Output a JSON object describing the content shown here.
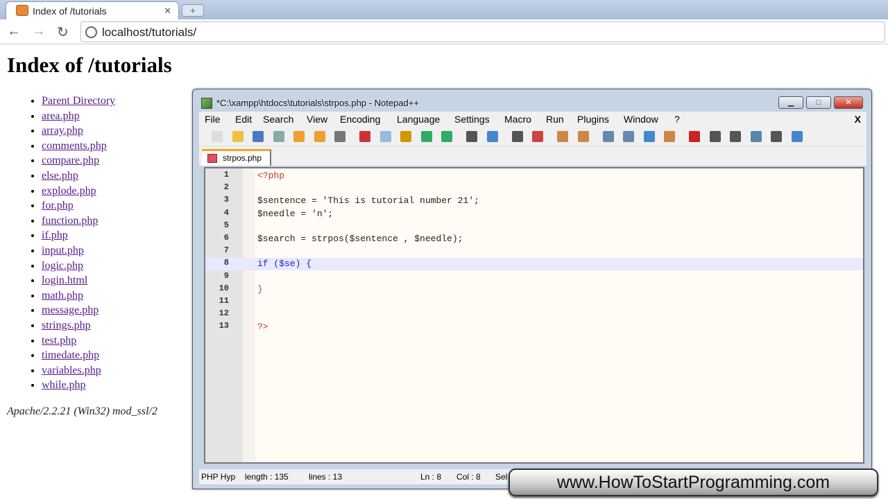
{
  "browser": {
    "tab_title": "Index of /tutorials",
    "url": "localhost/tutorials/"
  },
  "page": {
    "title": "Index of /tutorials",
    "links": [
      "Parent Directory",
      "area.php",
      "array.php",
      "comments.php",
      "compare.php",
      "else.php",
      "explode.php",
      "for.php",
      "function.php",
      "if.php",
      "input.php",
      "logic.php",
      "login.html",
      "math.php",
      "message.php",
      "strings.php",
      "test.php",
      "timedate.php",
      "variables.php",
      "while.php"
    ],
    "footer": "Apache/2.2.21 (Win32) mod_ssl/2"
  },
  "npp": {
    "title": "*C:\\xampp\\htdocs\\tutorials\\strpos.php - Notepad++",
    "menu": [
      "File",
      "Edit",
      "Search",
      "View",
      "Encoding",
      "Language",
      "Settings",
      "Macro",
      "Run",
      "Plugins",
      "Window",
      "?"
    ],
    "close_x": "X",
    "file_tab": "strpos.php",
    "lines": [
      {
        "n": "1",
        "t": "<?php",
        "c": "#d03030"
      },
      {
        "n": "2",
        "t": "",
        "c": "#000"
      },
      {
        "n": "3",
        "t": "$sentence = 'This is tutorial number 21';",
        "c": "#222"
      },
      {
        "n": "4",
        "t": "$needle = 'n';",
        "c": "#222"
      },
      {
        "n": "5",
        "t": "",
        "c": "#000"
      },
      {
        "n": "6",
        "t": "$search = strpos($sentence , $needle);",
        "c": "#222"
      },
      {
        "n": "7",
        "t": "",
        "c": "#000"
      },
      {
        "n": "8",
        "t": "if ($se) {",
        "c": "#2020c0"
      },
      {
        "n": "9",
        "t": "",
        "c": "#000"
      },
      {
        "n": "10",
        "t": "}",
        "c": "#666"
      },
      {
        "n": "11",
        "t": "",
        "c": "#000"
      },
      {
        "n": "12",
        "t": "",
        "c": "#000"
      },
      {
        "n": "13",
        "t": "?>",
        "c": "#d03030"
      }
    ],
    "status": {
      "lang": "PHP Hyp",
      "length": "length : 135",
      "lines": "lines : 13",
      "ln": "Ln : 8",
      "col": "Col : 8",
      "sel": "Sel"
    }
  },
  "watermark": "www.HowToStartProgramming.com"
}
